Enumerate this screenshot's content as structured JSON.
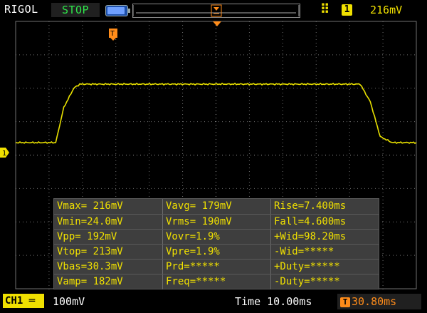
{
  "topbar": {
    "brand": "RIGOL",
    "run_state": "STOP",
    "trigger_level": "216mV",
    "trigger_channel": "1",
    "trigger_slope_icon": "rising-edge-icon"
  },
  "waveform": {
    "channel": "1",
    "trigger_marker": "T",
    "color": "#e8e000",
    "description_points": [
      [
        0,
        0.0
      ],
      [
        1,
        0.0
      ],
      [
        1.2,
        0.6
      ],
      [
        1.45,
        0.93
      ],
      [
        1.6,
        1.0
      ],
      [
        8.6,
        1.0
      ],
      [
        8.85,
        0.7
      ],
      [
        9.1,
        0.1
      ],
      [
        9.4,
        0.0
      ],
      [
        10,
        0.0
      ]
    ]
  },
  "measurements": {
    "rows": [
      [
        "Vmax= 216mV",
        "Vavg= 179mV",
        "Rise=7.400ms"
      ],
      [
        "Vmin=24.0mV",
        "Vrms= 190mV",
        "Fall=4.600ms"
      ],
      [
        "Vpp= 192mV",
        "Vovr=1.9%",
        "+Wid=98.20ms"
      ],
      [
        "Vtop= 213mV",
        "Vpre=1.9%",
        "-Wid=*****"
      ],
      [
        "Vbas=30.3mV",
        "Prd=*****",
        "+Duty=*****"
      ],
      [
        "Vamp= 182mV",
        "Freq=*****",
        "-Duty=*****"
      ]
    ]
  },
  "bottombar": {
    "channel_label": "CH1",
    "channel_scale": "100mV",
    "timebase": "Time 10.00ms",
    "trigger_offset": "30.80ms",
    "trigger_offset_icon_label": "T"
  },
  "colors": {
    "trace": "#e8e000",
    "accent_orange": "#ff8c1a",
    "run_state_green": "#2ee64a",
    "panel_gray": "#3e3e3e"
  }
}
